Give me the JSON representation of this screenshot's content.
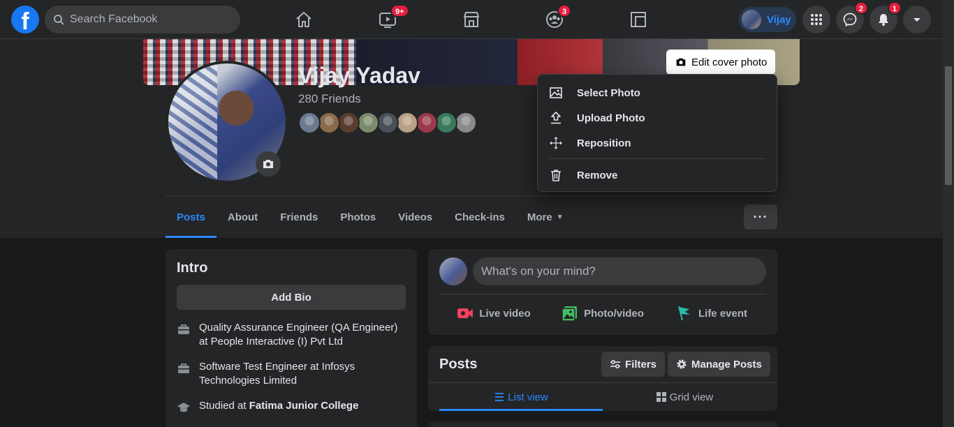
{
  "search": {
    "placeholder": "Search Facebook"
  },
  "nav": {
    "home": {
      "icon": "home-icon"
    },
    "watch": {
      "icon": "watch-icon",
      "badge": "9+"
    },
    "marketplace": {
      "icon": "marketplace-icon"
    },
    "groups": {
      "icon": "groups-icon",
      "badge": "3"
    },
    "gaming": {
      "icon": "gaming-icon"
    }
  },
  "account": {
    "name": "Vijay",
    "menu_icon": "grid-menu-icon",
    "messenger_badge": "2",
    "notifications_badge": "1"
  },
  "cover": {
    "edit_label": "Edit cover photo"
  },
  "cover_menu": {
    "items": [
      {
        "label": "Select Photo",
        "icon": "photo-select-icon"
      },
      {
        "label": "Upload Photo",
        "icon": "upload-icon"
      },
      {
        "label": "Reposition",
        "icon": "move-icon"
      },
      {
        "label": "Remove",
        "icon": "trash-icon"
      }
    ]
  },
  "profile": {
    "name": "Vijay Yadav",
    "friends_count": "280 Friends",
    "friend_avatar_colors": [
      "#6b7a8f",
      "#8a6a4a",
      "#5a3c2e",
      "#7b8a6a",
      "#4a4f5a",
      "#b8a088",
      "#9a3a4a",
      "#3a7a5a",
      "#8a8a8a"
    ]
  },
  "tabs": [
    {
      "label": "Posts",
      "active": true
    },
    {
      "label": "About"
    },
    {
      "label": "Friends"
    },
    {
      "label": "Photos"
    },
    {
      "label": "Videos"
    },
    {
      "label": "Check-ins"
    },
    {
      "label": "More"
    }
  ],
  "more_button": "···",
  "intro": {
    "title": "Intro",
    "add_bio": "Add Bio",
    "items": [
      {
        "icon": "briefcase-icon",
        "text": "Quality Assurance Engineer (QA Engineer) at People Interactive (I) Pvt Ltd"
      },
      {
        "icon": "briefcase-icon",
        "text": "Software Test Engineer at Infosys Technologies Limited"
      },
      {
        "icon": "graduation-cap-icon",
        "prefix": "Studied at ",
        "bold": "Fatima Junior College"
      }
    ]
  },
  "composer": {
    "placeholder": "What's on your mind?",
    "actions": [
      {
        "label": "Live video",
        "icon": "live-video-icon",
        "color": "#f3425f"
      },
      {
        "label": "Photo/video",
        "icon": "photo-video-icon",
        "color": "#45bd62"
      },
      {
        "label": "Life event",
        "icon": "flag-icon",
        "color": "#2abba7"
      }
    ]
  },
  "posts": {
    "title": "Posts",
    "filters": "Filters",
    "manage": "Manage Posts",
    "list_view": "List view",
    "grid_view": "Grid view"
  },
  "colors": {
    "accent": "#2d88ff",
    "badge": "#e41e3f",
    "surface": "#242526",
    "background": "#18191a"
  }
}
